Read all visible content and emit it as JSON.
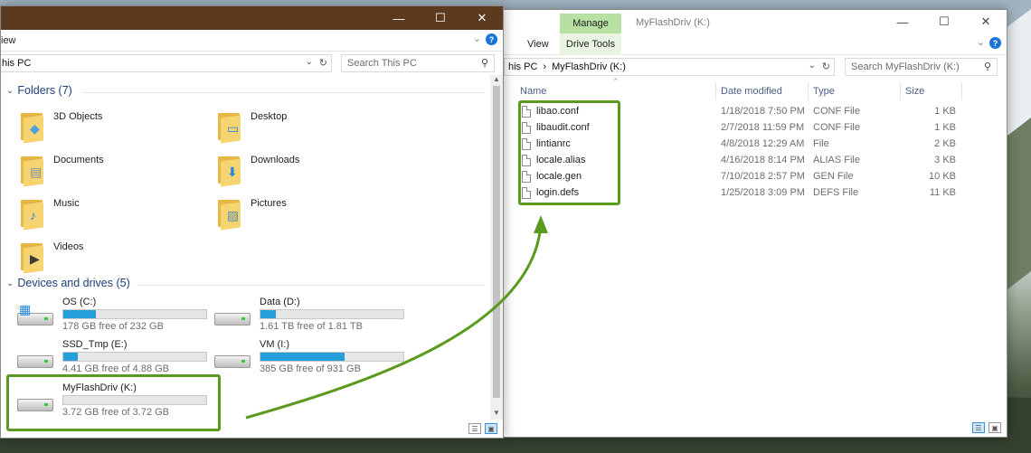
{
  "left_window": {
    "ribbon_view": "iew",
    "address": "his PC",
    "search_placeholder": "Search This PC",
    "folders_header": "Folders (7)",
    "folders": [
      {
        "name": "3D Objects",
        "icon": "3d-objects-folder-icon"
      },
      {
        "name": "Desktop",
        "icon": "desktop-folder-icon"
      },
      {
        "name": "Documents",
        "icon": "documents-folder-icon"
      },
      {
        "name": "Downloads",
        "icon": "downloads-folder-icon"
      },
      {
        "name": "Music",
        "icon": "music-folder-icon"
      },
      {
        "name": "Pictures",
        "icon": "pictures-folder-icon"
      },
      {
        "name": "Videos",
        "icon": "videos-folder-icon"
      }
    ],
    "drives_header": "Devices and drives (5)",
    "drives": [
      {
        "name": "OS (C:)",
        "free": "178 GB free of 232 GB",
        "used_fraction": 0.23
      },
      {
        "name": "Data (D:)",
        "free": "1.61 TB free of 1.81 TB",
        "used_fraction": 0.11
      },
      {
        "name": "SSD_Tmp (E:)",
        "free": "4.41 GB free of 4.88 GB",
        "used_fraction": 0.1
      },
      {
        "name": "VM (I:)",
        "free": "385 GB free of 931 GB",
        "used_fraction": 0.59
      },
      {
        "name": "MyFlashDriv (K:)",
        "free": "3.72 GB free of 3.72 GB",
        "used_fraction": 0.0
      }
    ]
  },
  "right_window": {
    "manage_tab": "Manage",
    "title": "MyFlashDriv (K:)",
    "view_tab": "View",
    "drive_tools_tab": "Drive Tools",
    "address_prefix": "his PC",
    "address_sep": "›",
    "address_current": "MyFlashDriv (K:)",
    "search_placeholder": "Search MyFlashDriv (K:)",
    "columns": {
      "name": "Name",
      "date": "Date modified",
      "type": "Type",
      "size": "Size"
    },
    "files": [
      {
        "name": "libao.conf",
        "date": "1/18/2018 7:50 PM",
        "type": "CONF File",
        "size": "1 KB"
      },
      {
        "name": "libaudit.conf",
        "date": "2/7/2018 11:59 PM",
        "type": "CONF File",
        "size": "1 KB"
      },
      {
        "name": "lintianrc",
        "date": "4/8/2018 12:29 AM",
        "type": "File",
        "size": "2 KB"
      },
      {
        "name": "locale.alias",
        "date": "4/16/2018 8:14 PM",
        "type": "ALIAS File",
        "size": "3 KB"
      },
      {
        "name": "locale.gen",
        "date": "7/10/2018 2:57 PM",
        "type": "GEN File",
        "size": "10 KB"
      },
      {
        "name": "login.defs",
        "date": "1/25/2018 3:09 PM",
        "type": "DEFS File",
        "size": "11 KB"
      }
    ]
  },
  "colors": {
    "highlight": "#5a9a1e",
    "bar_fill": "#26a0da",
    "section_blue": "#1e3f78"
  }
}
